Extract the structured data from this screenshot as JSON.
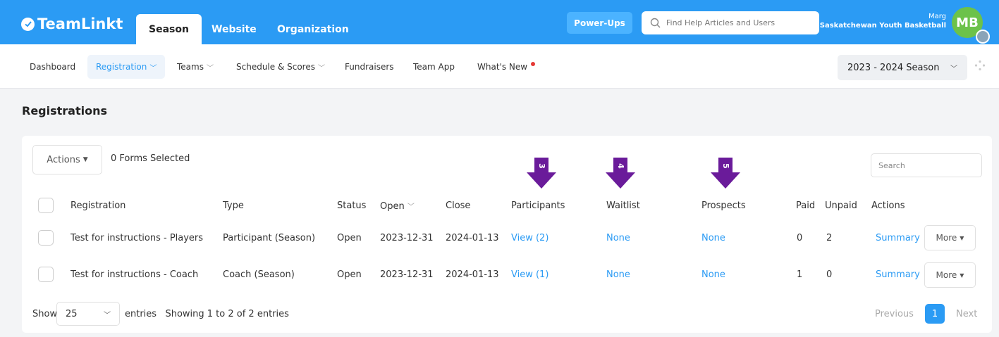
{
  "app": {
    "logo_text": "TeamLinkt"
  },
  "top_tabs": [
    {
      "label": "Season"
    },
    {
      "label": "Website"
    },
    {
      "label": "Organization"
    }
  ],
  "header": {
    "powerups_label": "Power-Ups",
    "search_placeholder": "Find Help Articles and Users",
    "user_name": "Marg",
    "org_name": "Saskatchewan Youth Basketball",
    "avatar_initials": "MB"
  },
  "subnav": {
    "items": [
      {
        "label": "Dashboard"
      },
      {
        "label": "Registration"
      },
      {
        "label": "Teams"
      },
      {
        "label": "Schedule & Scores"
      },
      {
        "label": "Fundraisers"
      },
      {
        "label": "Team App"
      },
      {
        "label": "What's New"
      }
    ],
    "season": "2023 - 2024 Season"
  },
  "page": {
    "title": "Registrations",
    "actions_label": "Actions",
    "forms_selected": "0 Forms Selected",
    "search_placeholder": "Search"
  },
  "arrows": [
    {
      "number": "3"
    },
    {
      "number": "4"
    },
    {
      "number": "5"
    }
  ],
  "table": {
    "columns": [
      "Registration",
      "Type",
      "Status",
      "Open",
      "Close",
      "Participants",
      "Waitlist",
      "Prospects",
      "Paid",
      "Unpaid",
      "Actions"
    ],
    "rows": [
      {
        "registration": "Test for instructions - Players",
        "type": "Participant (Season)",
        "status": "Open",
        "open": "2023-12-31",
        "close": "2024-01-13",
        "participants": "View (2)",
        "waitlist": "None",
        "prospects": "None",
        "paid": "0",
        "unpaid": "2",
        "summary": "Summary",
        "more": "More"
      },
      {
        "registration": "Test for instructions - Coach",
        "type": "Coach (Season)",
        "status": "Open",
        "open": "2023-12-31",
        "close": "2024-01-13",
        "participants": "View (1)",
        "waitlist": "None",
        "prospects": "None",
        "paid": "1",
        "unpaid": "0",
        "summary": "Summary",
        "more": "More"
      }
    ]
  },
  "footer": {
    "show_label": "Show",
    "entries_value": "25",
    "entries_text": "entries   Showing 1 to 2 of 2 entries",
    "previous": "Previous",
    "page": "1",
    "next": "Next"
  },
  "colors": {
    "brand_blue": "#2b9bf4",
    "annotation_purple": "#6a1b9a",
    "avatar_green": "#6cc24a"
  }
}
